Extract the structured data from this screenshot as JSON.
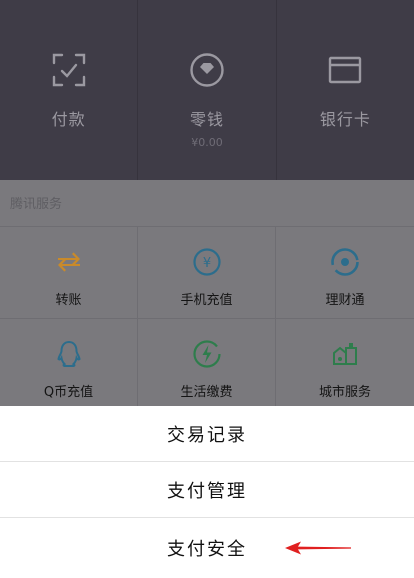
{
  "wallet": {
    "items": [
      {
        "label": "付款",
        "icon": "scan-frame-icon"
      },
      {
        "label": "零钱",
        "sub": "¥0.00",
        "icon": "coin-icon"
      },
      {
        "label": "银行卡",
        "icon": "bank-card-icon"
      }
    ]
  },
  "services": {
    "title": "腾讯服务",
    "items": [
      {
        "label": "转账",
        "icon": "transfer-icon",
        "color": "#c98a2a"
      },
      {
        "label": "手机充值",
        "icon": "phone-recharge-icon",
        "color": "#2c6d8c"
      },
      {
        "label": "理财通",
        "icon": "wealth-icon",
        "color": "#2c6d8c"
      },
      {
        "label": "Q币充值",
        "icon": "penguin-icon",
        "color": "#2c6d8c"
      },
      {
        "label": "生活缴费",
        "icon": "bolt-icon",
        "color": "#2e7d4c"
      },
      {
        "label": "城市服务",
        "icon": "city-service-icon",
        "color": "#2e7d4c"
      }
    ]
  },
  "action_sheet": {
    "items": [
      "交易记录",
      "支付管理",
      "支付安全"
    ]
  },
  "colors": {
    "header_bg": "#3f3c47",
    "overlay_bg": "#7a797d",
    "sheet_bg": "#ffffff",
    "annotation_arrow": "#e02020"
  }
}
